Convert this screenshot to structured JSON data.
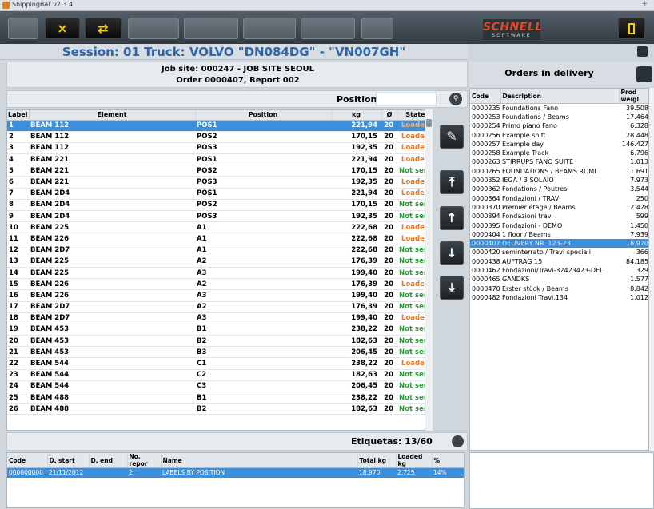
{
  "window": {
    "title": "ShippingBar v2.3.4",
    "pin": "+"
  },
  "toolbar": {
    "buttons": [
      {
        "icon": "disabled-arrow-icon",
        "label": ""
      },
      {
        "icon": "close-icon",
        "label": "×"
      },
      {
        "icon": "transfer-icon",
        "label": "⇄"
      },
      {
        "icon": "disabled-icon",
        "label": ""
      },
      {
        "icon": "disabled-icon",
        "label": ""
      },
      {
        "icon": "disabled-icon",
        "label": ""
      },
      {
        "icon": "disabled-icon",
        "label": ""
      },
      {
        "icon": "disabled-icon",
        "label": ""
      }
    ],
    "logo_main": "SCHNELL",
    "logo_sub": "SOFTWARE"
  },
  "session": {
    "title": "Session: 01   Truck: VOLVO \"DN084DG\" - \"VN007GH\""
  },
  "job": {
    "site": "Job site: 000247 - JOB SITE SEOUL",
    "order": "Order 0000407, Report 002"
  },
  "position": {
    "label": "Position",
    "placeholder": ""
  },
  "main_table": {
    "headers": [
      "Label",
      "Element",
      "Position",
      "kg",
      "Ø",
      "State"
    ],
    "rows": [
      [
        "1",
        "BEAM 112",
        "POS1",
        "221,94",
        "20",
        "Loaded"
      ],
      [
        "2",
        "BEAM 112",
        "POS2",
        "170,15",
        "20",
        "Loaded"
      ],
      [
        "3",
        "BEAM 112",
        "POS3",
        "192,35",
        "20",
        "Loaded"
      ],
      [
        "4",
        "BEAM 221",
        "POS1",
        "221,94",
        "20",
        "Loaded"
      ],
      [
        "5",
        "BEAM 221",
        "POS2",
        "170,15",
        "20",
        "Not sent"
      ],
      [
        "6",
        "BEAM 221",
        "POS3",
        "192,35",
        "20",
        "Loaded"
      ],
      [
        "7",
        "BEAM 2D4",
        "POS1",
        "221,94",
        "20",
        "Loaded"
      ],
      [
        "8",
        "BEAM 2D4",
        "POS2",
        "170,15",
        "20",
        "Not sent"
      ],
      [
        "9",
        "BEAM 2D4",
        "POS3",
        "192,35",
        "20",
        "Not sent"
      ],
      [
        "10",
        "BEAM 225",
        "A1",
        "222,68",
        "20",
        "Loaded"
      ],
      [
        "11",
        "BEAM 226",
        "A1",
        "222,68",
        "20",
        "Loaded"
      ],
      [
        "12",
        "BEAM 2D7",
        "A1",
        "222,68",
        "20",
        "Not sent"
      ],
      [
        "13",
        "BEAM 225",
        "A2",
        "176,39",
        "20",
        "Not sent"
      ],
      [
        "14",
        "BEAM 225",
        "A3",
        "199,40",
        "20",
        "Not sent"
      ],
      [
        "15",
        "BEAM 226",
        "A2",
        "176,39",
        "20",
        "Loaded"
      ],
      [
        "16",
        "BEAM 226",
        "A3",
        "199,40",
        "20",
        "Not sent"
      ],
      [
        "17",
        "BEAM 2D7",
        "A2",
        "176,39",
        "20",
        "Not sent"
      ],
      [
        "18",
        "BEAM 2D7",
        "A3",
        "199,40",
        "20",
        "Loaded"
      ],
      [
        "19",
        "BEAM 453",
        "B1",
        "238,22",
        "20",
        "Not sent"
      ],
      [
        "20",
        "BEAM 453",
        "B2",
        "182,63",
        "20",
        "Not sent"
      ],
      [
        "21",
        "BEAM 453",
        "B3",
        "206,45",
        "20",
        "Not sent"
      ],
      [
        "22",
        "BEAM 544",
        "C1",
        "238,22",
        "20",
        "Loaded"
      ],
      [
        "23",
        "BEAM 544",
        "C2",
        "182,63",
        "20",
        "Not sent"
      ],
      [
        "24",
        "BEAM 544",
        "C3",
        "206,45",
        "20",
        "Not sent"
      ],
      [
        "25",
        "BEAM 488",
        "B1",
        "238,22",
        "20",
        "Not sent"
      ],
      [
        "26",
        "BEAM 488",
        "B2",
        "182,63",
        "20",
        "Not sent"
      ]
    ]
  },
  "side_buttons": [
    {
      "icon": "edit-icon",
      "label": "✎"
    },
    {
      "icon": "first-icon",
      "label": "⤒"
    },
    {
      "icon": "up-icon",
      "label": "↑"
    },
    {
      "icon": "down-icon",
      "label": "↓"
    },
    {
      "icon": "last-icon",
      "label": "⤓"
    }
  ],
  "etiquetas": {
    "label": "Etiquetas: 13/60"
  },
  "bottom_table": {
    "headers": [
      "Code",
      "D. start",
      "D. end",
      "No. repor",
      "Name",
      "Total kg",
      "Loaded kg",
      "%"
    ],
    "rows": [
      [
        "000000000",
        "21/11/2012",
        "",
        "2",
        "LABELS BY POSITION",
        "18.970",
        "2.725",
        "14%"
      ]
    ]
  },
  "orders": {
    "title": "Orders in delivery",
    "headers": [
      "Code",
      "Description",
      "Prod weigl"
    ],
    "rows": [
      [
        "0000235",
        "Foundations Fano",
        "39.508"
      ],
      [
        "0000253",
        "Foundations / Beams",
        "17.464"
      ],
      [
        "0000254",
        "Primo piano Fano",
        "6.328"
      ],
      [
        "0000256",
        "Example shift",
        "28.448"
      ],
      [
        "0000257",
        "Example day",
        "146.427"
      ],
      [
        "0000258",
        "Example Track",
        "6.796"
      ],
      [
        "0000263",
        "STIRRUPS FANO SUITE",
        "1.013"
      ],
      [
        "0000265",
        "FOUNDATIONS / BEAMS ROMI",
        "1.691"
      ],
      [
        "0000352",
        "IEGA / 3 SOLAIO",
        "7.973"
      ],
      [
        "0000362",
        "Fondations / Poutres",
        "3.544"
      ],
      [
        "0000364",
        "Fondazioni / TRAVI",
        "250"
      ],
      [
        "0000370",
        "Premier étage / Beams",
        "2.428"
      ],
      [
        "0000394",
        "Fondazioni travi",
        "599"
      ],
      [
        "0000395",
        "Fondazioni - DEMO",
        "1.450"
      ],
      [
        "0000404",
        "1 floor / Beams",
        "7.939"
      ],
      [
        "0000407",
        "DELIVERY NR. 123-23",
        "18.970"
      ],
      [
        "0000420",
        "seminterrato / Travi speciali",
        "366"
      ],
      [
        "0000438",
        "AUFTRAG 15",
        "84.185"
      ],
      [
        "0000462",
        "Fondazioni/Travi-32423423-DEL",
        "329"
      ],
      [
        "0000465",
        "GANDKS",
        "1.577"
      ],
      [
        "0000470",
        "Erster stück / Beams",
        "8.842"
      ],
      [
        "0000482",
        "Fondazioni Travi,134",
        "1.012"
      ]
    ]
  },
  "colors": {
    "selection": "#3b8fdc",
    "loaded": "#e87722",
    "not_sent": "#2d9a3a",
    "title_blue": "#2e66aa"
  }
}
